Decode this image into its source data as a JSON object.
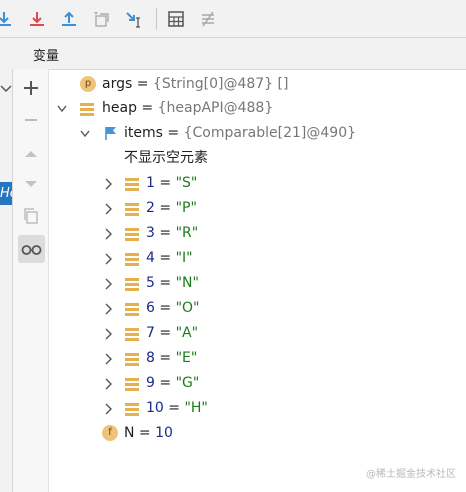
{
  "tab": {
    "label": "变量"
  },
  "left_frame": {
    "selected_text": "He"
  },
  "tree": {
    "args": {
      "badge": "p",
      "name": "args",
      "eq": " = ",
      "value": "{String[0]@487} []"
    },
    "heap": {
      "name": "heap",
      "eq": " = ",
      "value": "{heapAPI@488}"
    },
    "items": {
      "name": "items",
      "eq": " = ",
      "value": "{Comparable[21]@490}"
    },
    "hint": "不显示空元素",
    "elements": [
      {
        "index": "1",
        "eq": " = ",
        "value": "\"S\""
      },
      {
        "index": "2",
        "eq": " = ",
        "value": "\"P\""
      },
      {
        "index": "3",
        "eq": " = ",
        "value": "\"R\""
      },
      {
        "index": "4",
        "eq": " = ",
        "value": "\"I\""
      },
      {
        "index": "5",
        "eq": " = ",
        "value": "\"N\""
      },
      {
        "index": "6",
        "eq": " = ",
        "value": "\"O\""
      },
      {
        "index": "7",
        "eq": " = ",
        "value": "\"A\""
      },
      {
        "index": "8",
        "eq": " = ",
        "value": "\"E\""
      },
      {
        "index": "9",
        "eq": " = ",
        "value": "\"G\""
      },
      {
        "index": "10",
        "eq": " = ",
        "value": "\"H\""
      }
    ],
    "n": {
      "badge": "f",
      "name": "N",
      "eq": " = ",
      "value": "10"
    }
  },
  "watermark": "@稀土掘金技术社区",
  "icons": [
    "step-over-icon",
    "step-into-icon",
    "step-out-icon",
    "drop-frame-icon",
    "run-to-cursor-icon",
    "evaluate-icon",
    "trace-icon",
    "add-watch-icon",
    "remove-watch-icon",
    "up-icon",
    "down-icon",
    "copy-icon",
    "glasses-icon"
  ]
}
